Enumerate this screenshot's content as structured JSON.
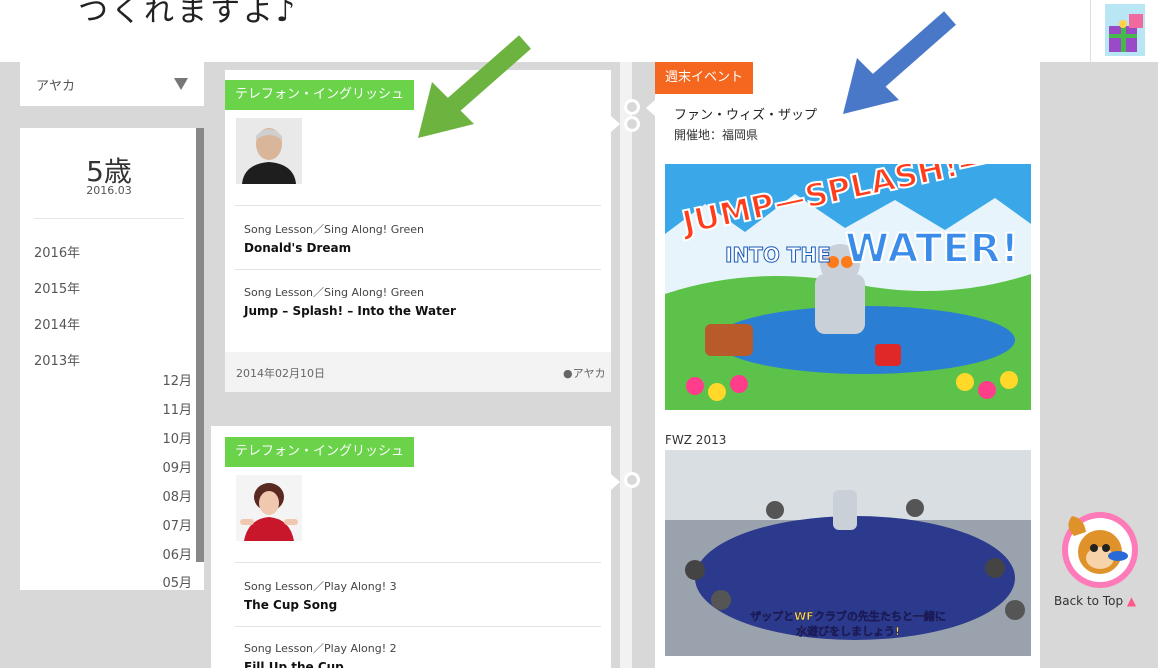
{
  "header": {
    "text": "つくれますよ♪"
  },
  "sidebar": {
    "user_name": "アヤカ",
    "age_label": "5歳",
    "age_date": "2016.03",
    "years": [
      "2016年",
      "2015年",
      "2014年",
      "2013年"
    ],
    "months": [
      "12月",
      "11月",
      "10月",
      "09月",
      "08月",
      "07月",
      "06月",
      "05月"
    ]
  },
  "cards": [
    {
      "tag": "テレフォン・イングリッシュ",
      "lessons": [
        {
          "type": "Song Lesson／Sing Along! Green",
          "title": "Donald's Dream"
        },
        {
          "type": "Song Lesson／Sing Along! Green",
          "title": "Jump – Splash! – Into the Water"
        }
      ],
      "date": "2014年02月10日",
      "user": "アヤカ"
    },
    {
      "tag": "テレフォン・イングリッシュ",
      "lessons": [
        {
          "type": "Song Lesson／Play Along! 3",
          "title": "The Cup Song"
        },
        {
          "type": "Song Lesson／Play Along! 2",
          "title": "Fill Up the Cup"
        }
      ]
    }
  ],
  "event": {
    "tag": "週末イベント",
    "name": "ファン・ウィズ・ザップ",
    "place": "開催地：福岡県",
    "poster_text_1": "JUMP—SPLASH!—",
    "poster_text_2": "INTO THE",
    "poster_text_3": "WATER!",
    "photo_caption": "FWZ 2013",
    "photo_subtitle_1": "ザップとWFクラブの先生たちと一緒に",
    "photo_subtitle_2": "水遊びをしましょう!"
  },
  "back_to_top": {
    "label": "Back to Top",
    "triangle": "▲"
  },
  "colors": {
    "green_tag": "#6ad34a",
    "orange_tag": "#f5661e",
    "arrow_green": "#6db33f",
    "arrow_blue": "#4a78c8"
  }
}
